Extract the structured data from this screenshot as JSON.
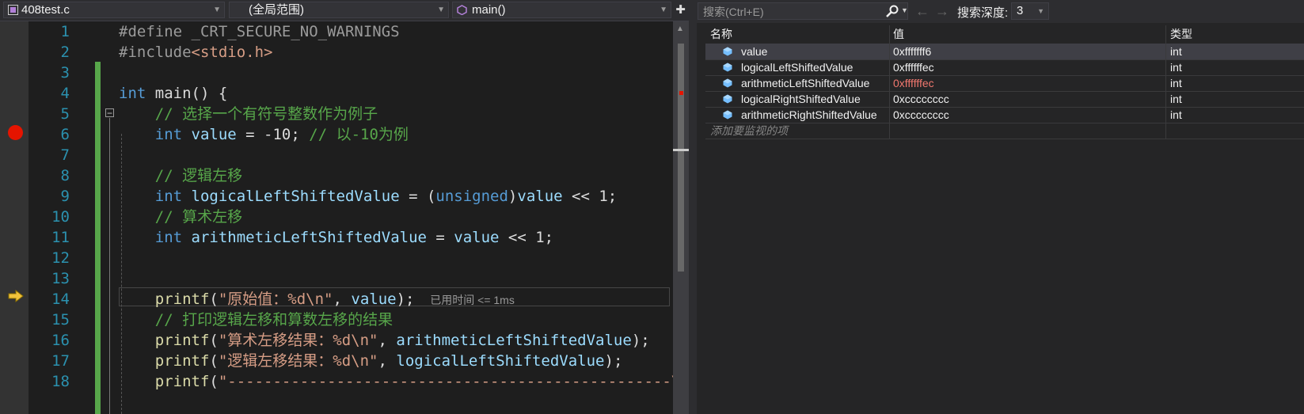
{
  "editor": {
    "file_dropdown": "408test.c",
    "scope_dropdown": "(全局范围)",
    "member_dropdown": "main()",
    "line_numbers": [
      "1",
      "2",
      "3",
      "4",
      "5",
      "6",
      "7",
      "8",
      "9",
      "10",
      "11",
      "12",
      "13",
      "14",
      "15",
      "16",
      "17",
      "18"
    ],
    "lines": [
      [
        {
          "t": "#define _CRT_SECURE_NO_WARNINGS",
          "c": "pp"
        }
      ],
      [
        {
          "t": "#include",
          "c": "pp"
        },
        {
          "t": "<stdio.h>",
          "c": "hdr"
        }
      ],
      [],
      [
        {
          "t": "int",
          "c": "kw"
        },
        {
          "t": " main() {",
          "c": ""
        }
      ],
      [
        {
          "t": "    // 选择一个有符号整数作为例子",
          "c": "cm"
        }
      ],
      [
        {
          "t": "    ",
          "c": ""
        },
        {
          "t": "int",
          "c": "kw"
        },
        {
          "t": " value",
          "c": "var"
        },
        {
          "t": " = -10; ",
          "c": ""
        },
        {
          "t": "// 以-10为例",
          "c": "cm"
        }
      ],
      [],
      [
        {
          "t": "    // 逻辑左移",
          "c": "cm"
        }
      ],
      [
        {
          "t": "    ",
          "c": ""
        },
        {
          "t": "int",
          "c": "kw"
        },
        {
          "t": " logicalLeftShiftedValue",
          "c": "var"
        },
        {
          "t": " = (",
          "c": ""
        },
        {
          "t": "unsigned",
          "c": "kw"
        },
        {
          "t": ")",
          "c": ""
        },
        {
          "t": "value",
          "c": "var"
        },
        {
          "t": " << 1;",
          "c": ""
        }
      ],
      [
        {
          "t": "    // 算术左移",
          "c": "cm"
        }
      ],
      [
        {
          "t": "    ",
          "c": ""
        },
        {
          "t": "int",
          "c": "kw"
        },
        {
          "t": " arithmeticLeftShiftedValue",
          "c": "var"
        },
        {
          "t": " = ",
          "c": ""
        },
        {
          "t": "value",
          "c": "var"
        },
        {
          "t": " << 1;",
          "c": ""
        }
      ],
      [],
      [],
      [
        {
          "t": "    ",
          "c": ""
        },
        {
          "t": "printf",
          "c": "fn"
        },
        {
          "t": "(",
          "c": ""
        },
        {
          "t": "\"原始值：%d\\n\"",
          "c": "str"
        },
        {
          "t": ", ",
          "c": ""
        },
        {
          "t": "value",
          "c": "var"
        },
        {
          "t": ");",
          "c": ""
        }
      ],
      [
        {
          "t": "    // 打印逻辑左移和算数左移的结果",
          "c": "cm"
        }
      ],
      [
        {
          "t": "    ",
          "c": ""
        },
        {
          "t": "printf",
          "c": "fn"
        },
        {
          "t": "(",
          "c": ""
        },
        {
          "t": "\"算术左移结果：%d\\n\"",
          "c": "str"
        },
        {
          "t": ", ",
          "c": ""
        },
        {
          "t": "arithmeticLeftShiftedValue",
          "c": "var"
        },
        {
          "t": ");",
          "c": ""
        }
      ],
      [
        {
          "t": "    ",
          "c": ""
        },
        {
          "t": "printf",
          "c": "fn"
        },
        {
          "t": "(",
          "c": ""
        },
        {
          "t": "\"逻辑左移结果：%d\\n\"",
          "c": "str"
        },
        {
          "t": ", ",
          "c": ""
        },
        {
          "t": "logicalLeftShiftedValue",
          "c": "var"
        },
        {
          "t": ");",
          "c": ""
        }
      ],
      [
        {
          "t": "    ",
          "c": ""
        },
        {
          "t": "printf",
          "c": "fn"
        },
        {
          "t": "(",
          "c": ""
        },
        {
          "t": "\"-------------------------------------------------\\n\"",
          "c": "str"
        }
      ]
    ],
    "elapsed_hint": "已用时间 <= 1ms",
    "breakpoint_line": 6,
    "current_line": 14
  },
  "watch": {
    "search_placeholder": "搜索(Ctrl+E)",
    "depth_label": "搜索深度:",
    "depth_value": "3",
    "columns": {
      "name": "名称",
      "value": "值",
      "type": "类型"
    },
    "rows": [
      {
        "name": "value",
        "value": "0xfffffff6",
        "type": "int",
        "changed": false
      },
      {
        "name": "logicalLeftShiftedValue",
        "value": "0xffffffec",
        "type": "int",
        "changed": false
      },
      {
        "name": "arithmeticLeftShiftedValue",
        "value": "0xffffffec",
        "type": "int",
        "changed": true
      },
      {
        "name": "logicalRightShiftedValue",
        "value": "0xcccccccc",
        "type": "int",
        "changed": false
      },
      {
        "name": "arithmeticRightShiftedValue",
        "value": "0xcccccccc",
        "type": "int",
        "changed": false
      }
    ],
    "add_watch_label": "添加要监视的项"
  },
  "colors": {
    "keyword": "#569cd6",
    "comment": "#57a64a",
    "string": "#d69d85",
    "line_number": "#2b91af",
    "breakpoint": "#e51400",
    "changed_value": "#f0776e"
  }
}
